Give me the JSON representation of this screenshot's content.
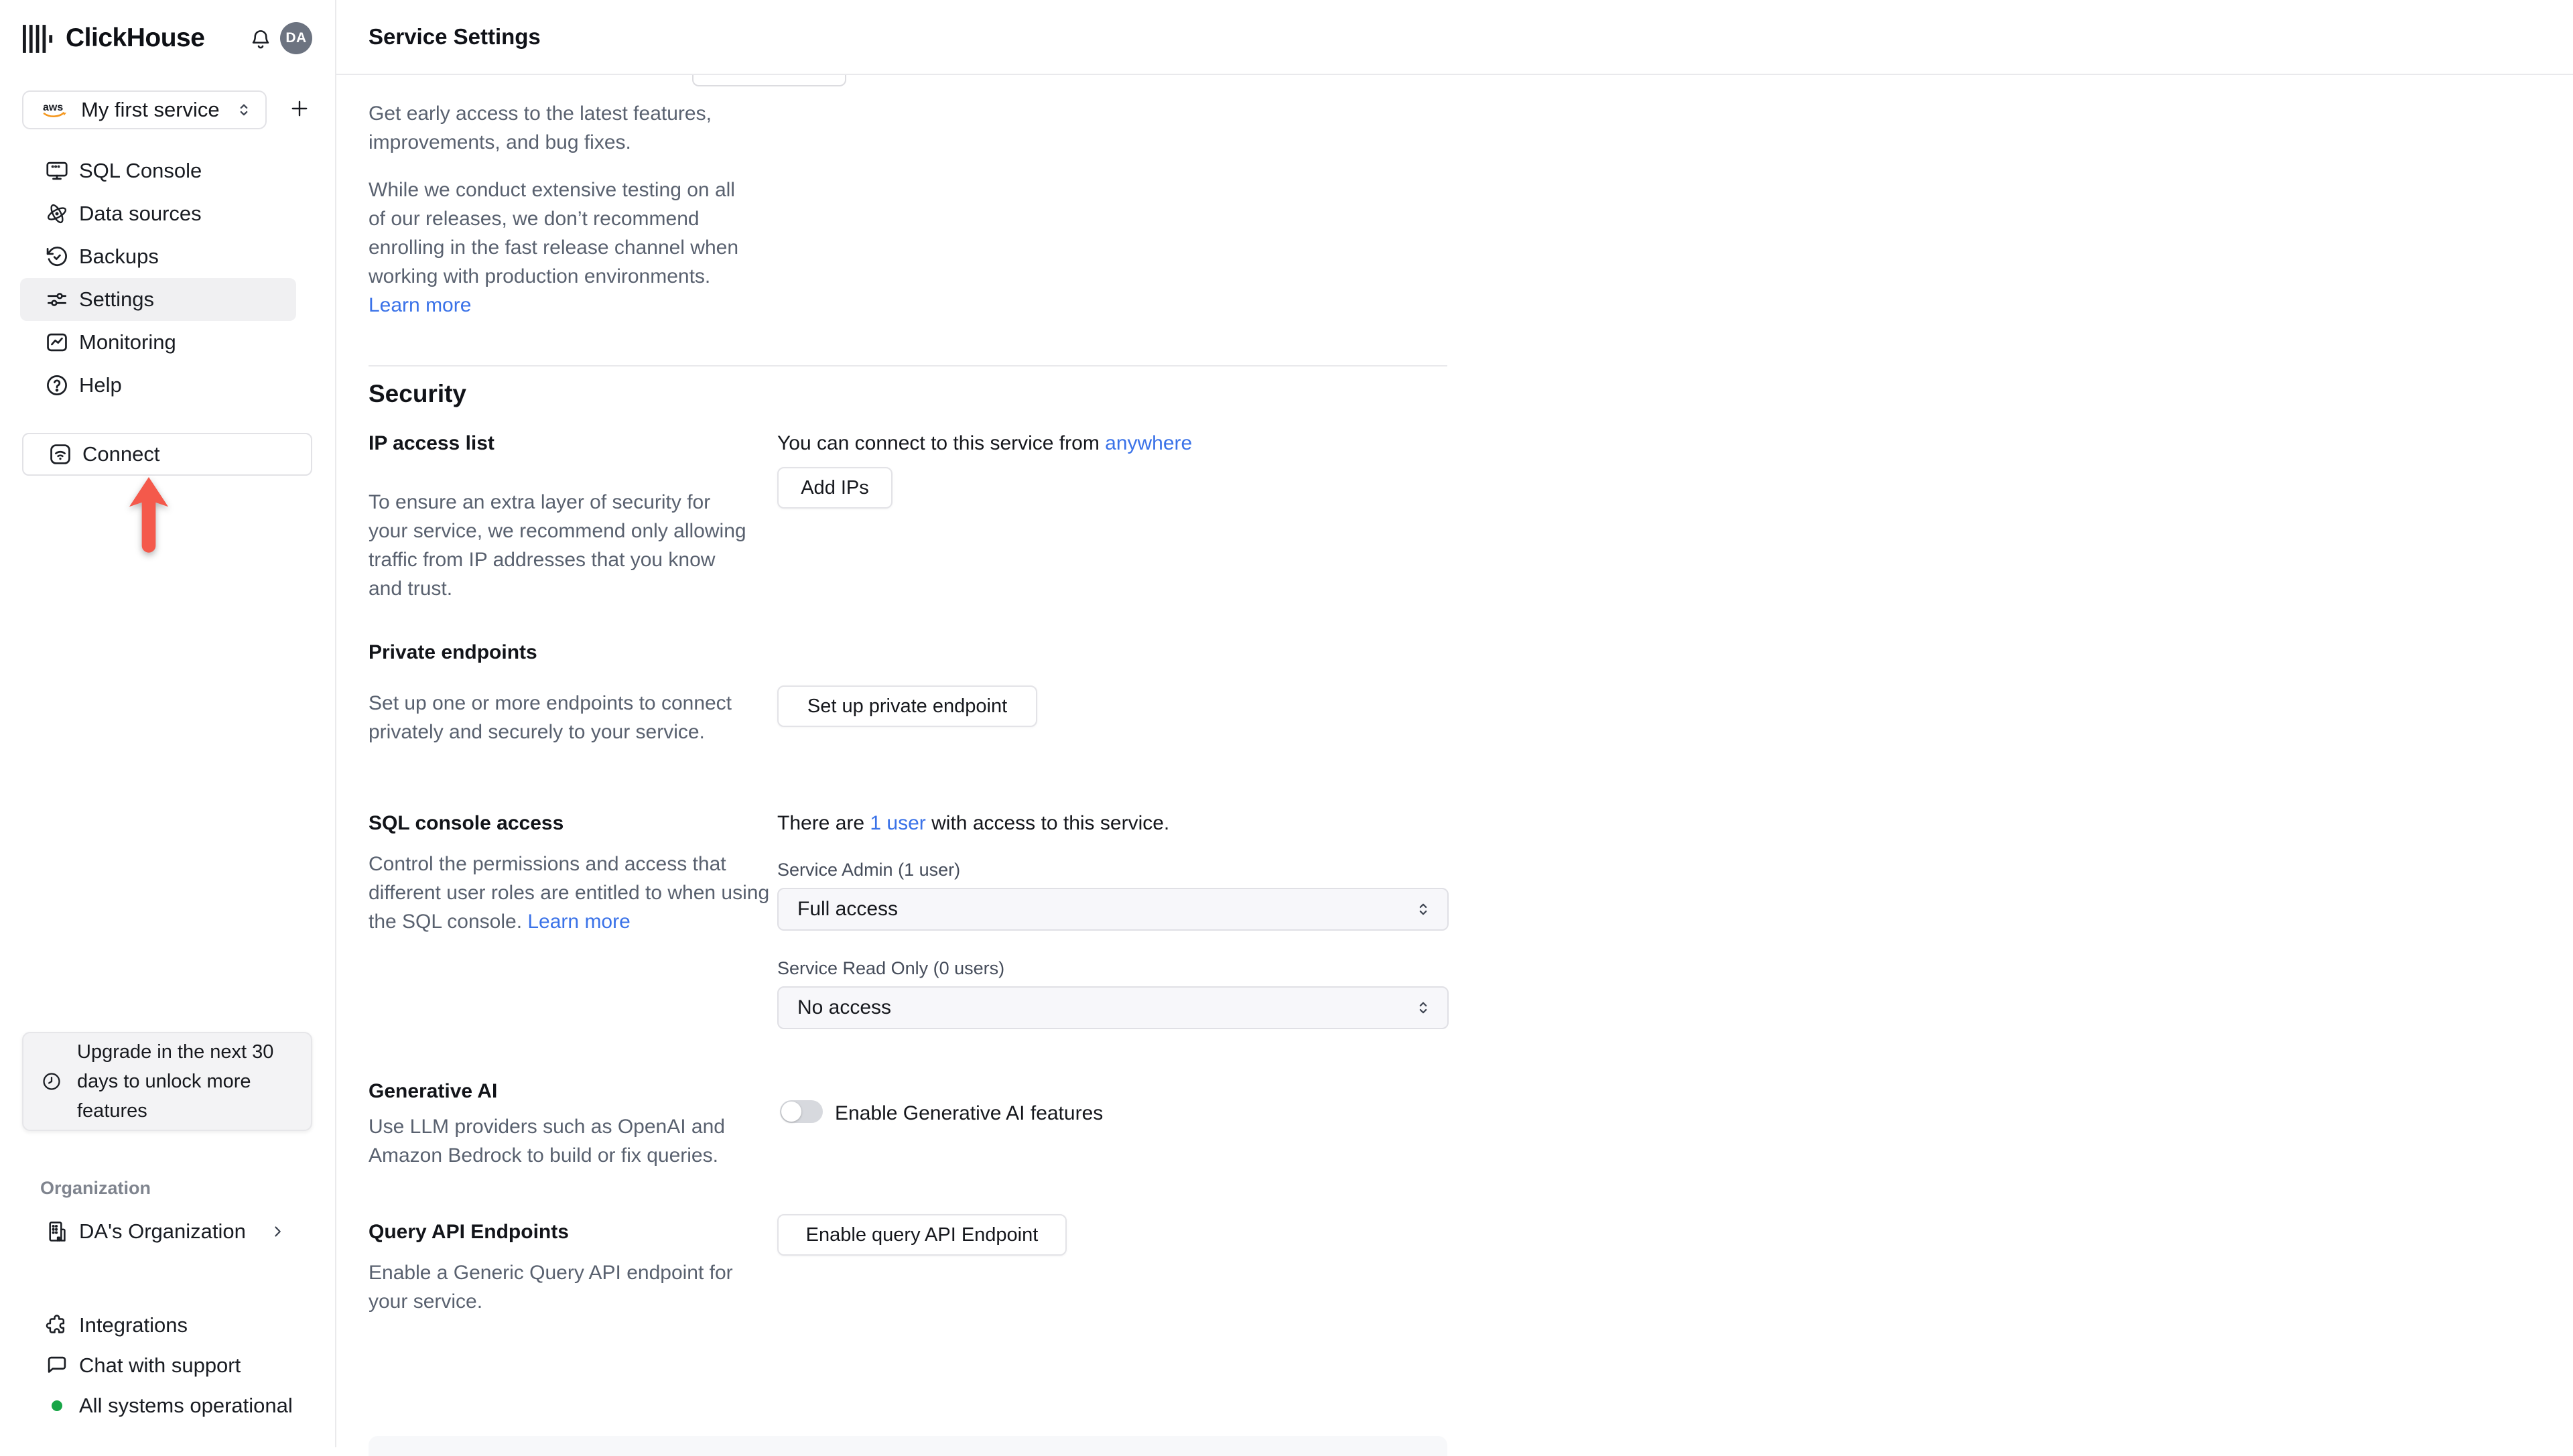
{
  "app": {
    "brand": "ClickHouse",
    "avatar_initials": "DA"
  },
  "sidebar": {
    "service_selector": {
      "label": "My first service",
      "provider_icon": "aws-logo"
    },
    "add_service_icon": "plus-icon",
    "nav": [
      {
        "label": "SQL Console",
        "icon": "terminal-monitor-icon"
      },
      {
        "label": "Data sources",
        "icon": "data-sources-orbit-icon"
      },
      {
        "label": "Backups",
        "icon": "backups-history-icon"
      },
      {
        "label": "Settings",
        "icon": "settings-sliders-icon",
        "active": true
      },
      {
        "label": "Monitoring",
        "icon": "monitoring-chart-icon"
      },
      {
        "label": "Help",
        "icon": "help-circle-icon"
      }
    ],
    "connect": {
      "label": "Connect",
      "icon": "connect-wifi-icon"
    },
    "annotation": {
      "type": "arrow-up",
      "color": "#F4594B",
      "target": "connect-button"
    },
    "upgrade_notice": {
      "icon": "clock-icon",
      "text": "Upgrade in the next 30 days to unlock more features"
    },
    "organization": {
      "section_label": "Organization",
      "name": "DA's Organization",
      "icon": "building-icon"
    },
    "footer": [
      {
        "label": "Integrations",
        "icon": "puzzle-icon"
      },
      {
        "label": "Chat with support",
        "icon": "chat-bubble-icon"
      }
    ],
    "status": {
      "label": "All systems operational",
      "color": "#17A546"
    }
  },
  "header": {
    "title": "Service Settings"
  },
  "content": {
    "fast_release": {
      "para1": "Get early access to the latest features, improvements, and bug fixes.",
      "para2": "While we conduct extensive testing on all of our releases, we don’t recommend enrolling in the fast release channel when working with production environments. ",
      "learn_more": "Learn more"
    },
    "security": {
      "heading": "Security",
      "ip_access": {
        "title": "IP access list",
        "connect_prefix": "You can connect to this service from ",
        "connect_link": "anywhere",
        "add_ips_button": "Add IPs",
        "description": "To ensure an extra layer of security for your service, we recommend only allowing traffic from IP addresses that you know and trust."
      },
      "private_endpoints": {
        "title": "Private endpoints",
        "description": "Set up one or more endpoints to connect privately and securely to your service.",
        "setup_button": "Set up private endpoint"
      },
      "sql_console_access": {
        "title": "SQL console access",
        "description": "Control the permissions and access that different user roles are entitled to when using the SQL console. ",
        "learn_more": "Learn more",
        "users_prefix": "There are ",
        "users_link": "1 user",
        "users_suffix": " with access to this service.",
        "service_admin_label": "Service Admin (1 user)",
        "service_admin_value": "Full access",
        "service_readonly_label": "Service Read Only (0 users)",
        "service_readonly_value": "No access"
      },
      "generative_ai": {
        "title": "Generative AI",
        "description": "Use LLM providers such as OpenAI and Amazon Bedrock to build or fix queries.",
        "toggle_label": "Enable Generative AI features",
        "toggle_state": "off"
      },
      "query_api": {
        "title": "Query API Endpoints",
        "description": "Enable a Generic Query API endpoint for your service.",
        "enable_button": "Enable query API Endpoint"
      }
    }
  },
  "colors": {
    "link_blue": "#3A72E8",
    "annotation_red": "#F4594B",
    "status_green": "#17A546",
    "avatar_bg": "#6C7380",
    "aws_orange": "#F5981F"
  }
}
